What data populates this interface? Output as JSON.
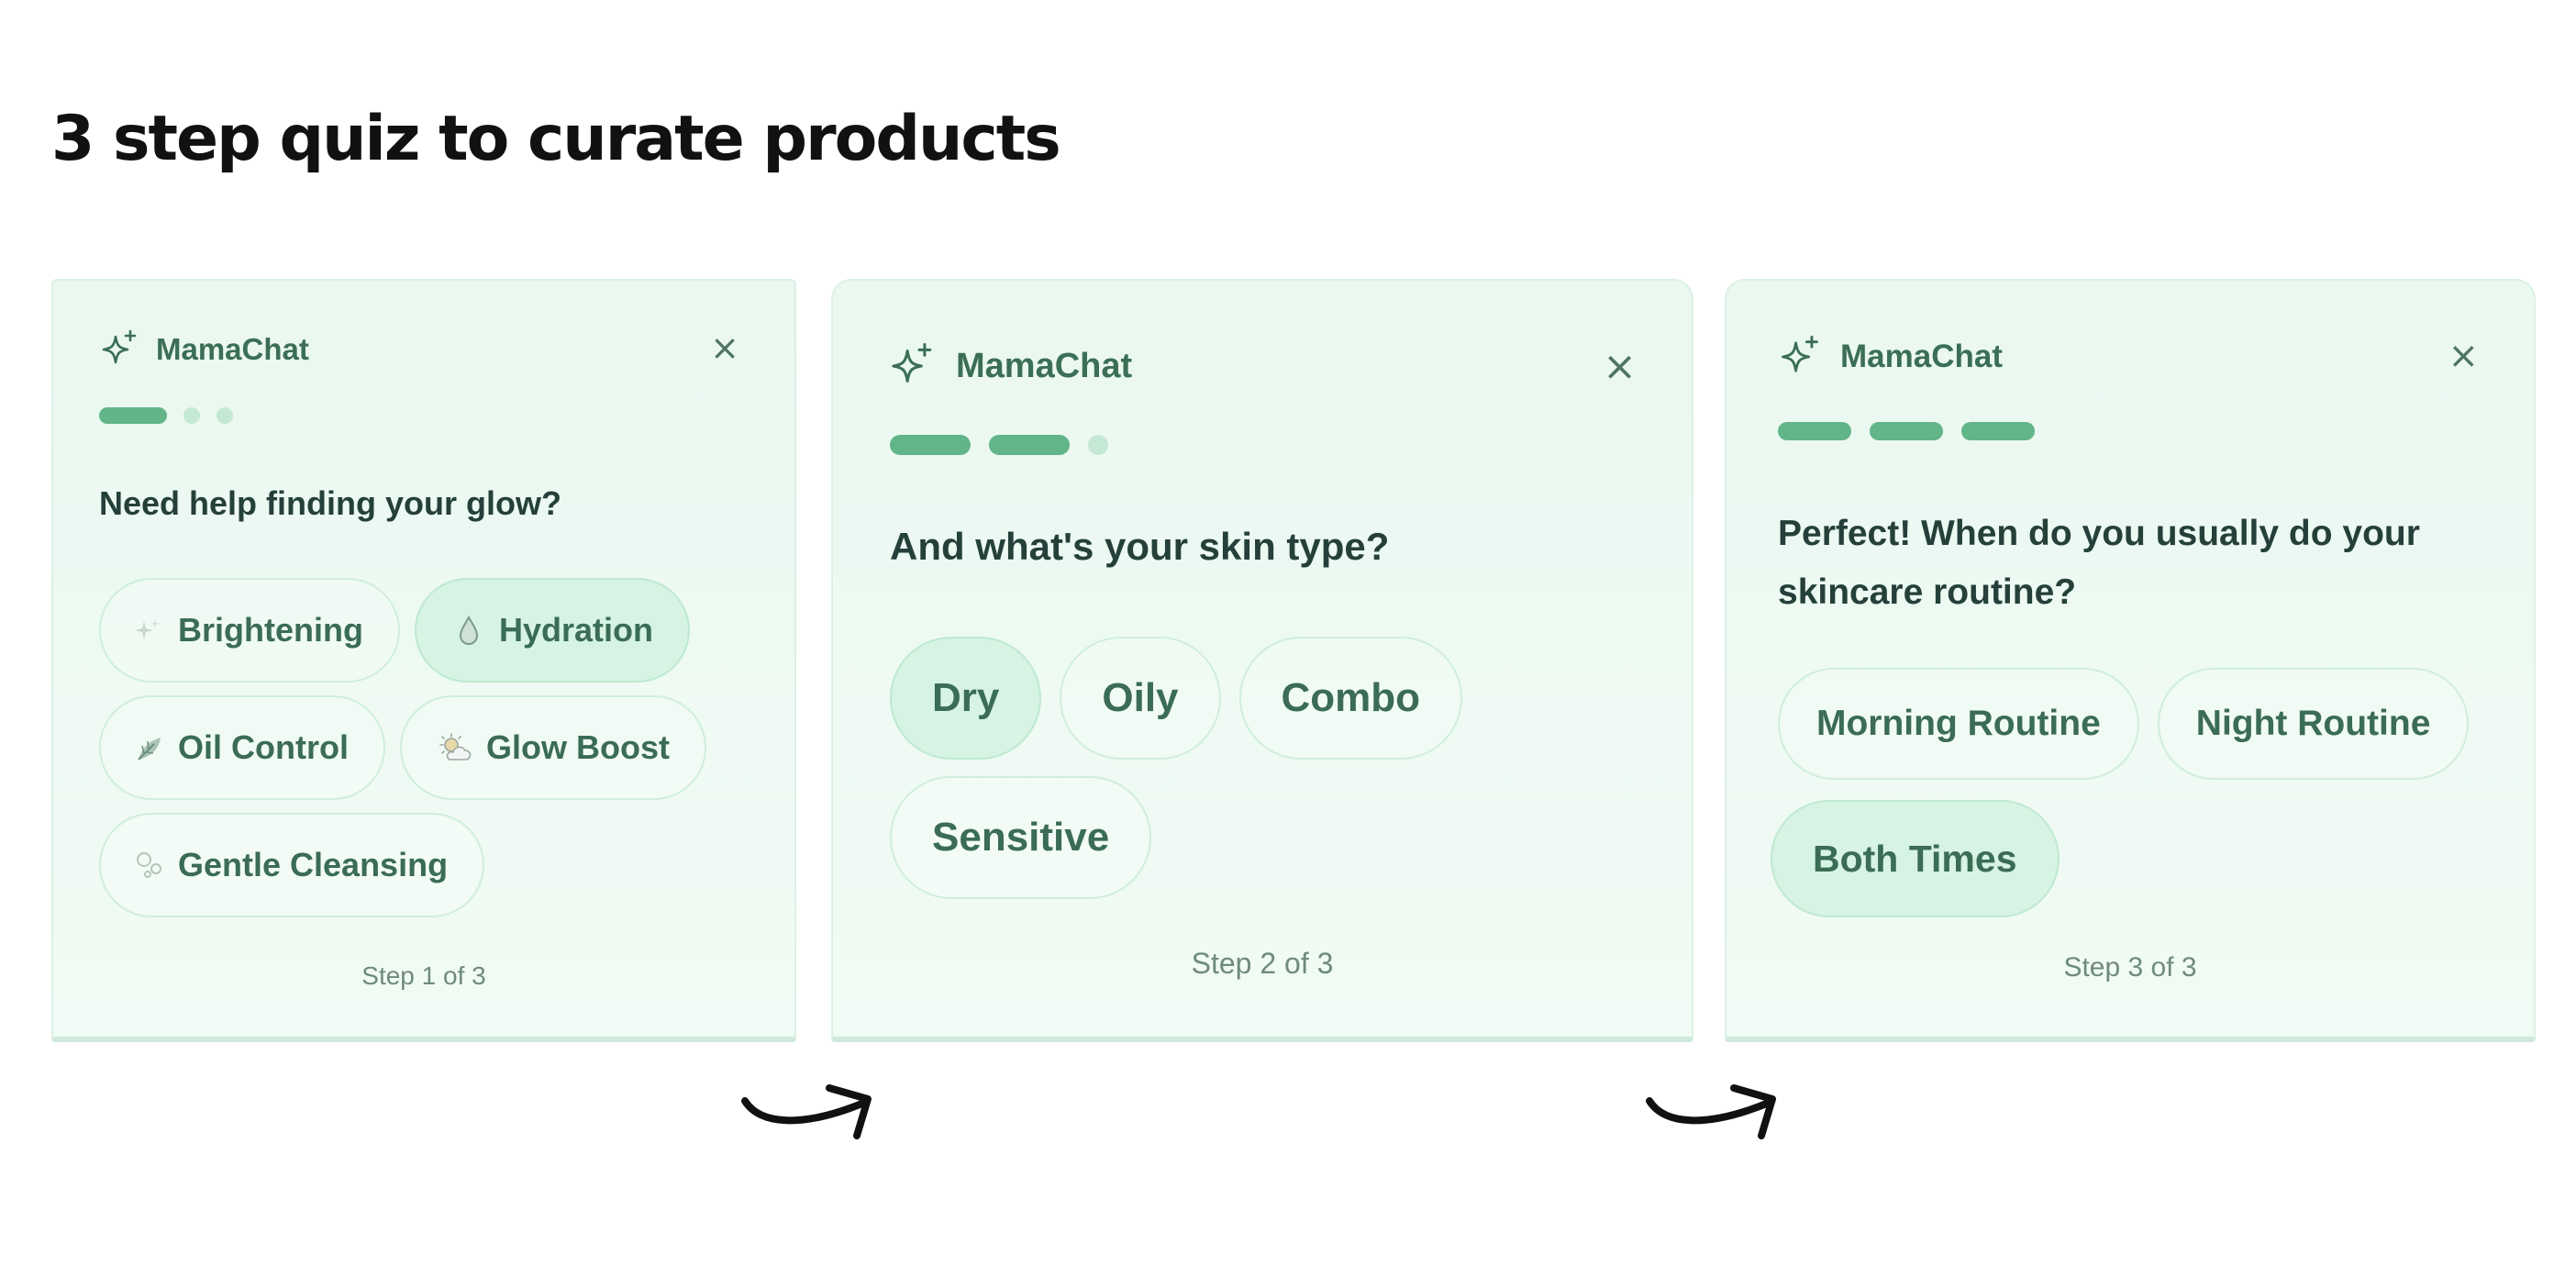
{
  "page": {
    "title": "3 step quiz to curate products"
  },
  "steps": [
    {
      "brand": "MamaChat",
      "close": "×",
      "progress": {
        "completed": 1,
        "total": 3
      },
      "question": "Need help finding your glow?",
      "options": [
        {
          "label": "Brightening",
          "icon": "sparkle-icon",
          "selected": false
        },
        {
          "label": "Hydration",
          "icon": "droplet-icon",
          "selected": true
        },
        {
          "label": "Oil Control",
          "icon": "leaf-icon",
          "selected": false
        },
        {
          "label": "Glow Boost",
          "icon": "sun-cloud-icon",
          "selected": false
        },
        {
          "label": "Gentle Cleansing",
          "icon": "bubbles-icon",
          "selected": false
        }
      ],
      "footer": "Step 1 of 3"
    },
    {
      "brand": "MamaChat",
      "close": "×",
      "progress": {
        "completed": 2,
        "total": 3
      },
      "question": "And what's your skin type?",
      "options": [
        {
          "label": "Dry",
          "selected": true
        },
        {
          "label": "Oily",
          "selected": false
        },
        {
          "label": "Combo",
          "selected": false
        },
        {
          "label": "Sensitive",
          "selected": false
        }
      ],
      "footer": "Step 2 of 3"
    },
    {
      "brand": "MamaChat",
      "close": "×",
      "progress": {
        "completed": 3,
        "total": 3
      },
      "question_line1": "Perfect! When do you usually do your",
      "question_line2": "skincare routine?",
      "options": [
        {
          "label": "Morning Routine",
          "selected": false
        },
        {
          "label": "Night Routine",
          "selected": false
        },
        {
          "label": "Both Times",
          "selected": true
        }
      ],
      "footer": "Step 3 of 3"
    }
  ],
  "colors": {
    "accent": "#62b489",
    "accent_light": "#c4e8d3",
    "chip_selected": "#d6f3e3",
    "card_bg": "#eaf8f0",
    "text_brand": "#3b6f55"
  }
}
